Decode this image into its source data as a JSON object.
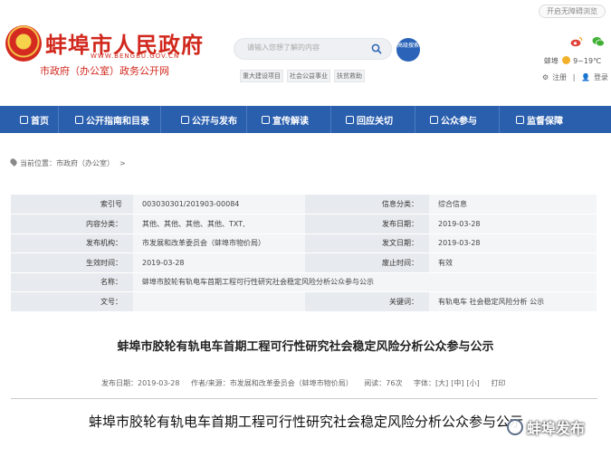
{
  "header": {
    "accessibility_label": "开启无障碍浏览",
    "site_title": "蚌埠市人民政府",
    "site_url": "WWW.BENGBU.GOV.CN",
    "site_subtitle": "市政府（办公室）政务公开网",
    "search_placeholder": "请输入您想了解的内容",
    "advanced_search_label": "高级搜索",
    "hot_tags": [
      "重大建设项目",
      "社会公益事业",
      "扶贫救助"
    ],
    "weather": {
      "city": "蚌埠",
      "temp": "9~19℃"
    },
    "user_links": {
      "register": "注册",
      "login": "登录"
    }
  },
  "nav": {
    "items": [
      {
        "label": "首页",
        "icon": "home-icon"
      },
      {
        "label": "公开指南和目录",
        "icon": "list-icon"
      },
      {
        "label": "公开与发布",
        "icon": "document-icon"
      },
      {
        "label": "宣传解读",
        "icon": "megaphone-icon"
      },
      {
        "label": "回应关切",
        "icon": "chat-icon"
      },
      {
        "label": "公众参与",
        "icon": "people-icon"
      },
      {
        "label": "监督保障",
        "icon": "shield-icon"
      }
    ]
  },
  "breadcrumb": {
    "prefix": "当前位置：",
    "item": "市政府（办公室）",
    "arrow": ">"
  },
  "meta": {
    "rows": [
      {
        "l1": "索引号",
        "v1": "003030301/201903-00084",
        "l2": "信息分类：",
        "v2": "综合信息"
      },
      {
        "l1": "内容分类：",
        "v1": "其他、其他、其他、其他、TXT,",
        "l2": "发布日期：",
        "v2": "2019-03-28"
      },
      {
        "l1": "发布机构：",
        "v1": "市发展和改革委员会（蚌埠市物价局）",
        "l2": "发文日期：",
        "v2": "2019-03-28"
      },
      {
        "l1": "生效时间：",
        "v1": "2019-03-28",
        "l2": "废止时间：",
        "v2": "有效"
      },
      {
        "l1": "名称：",
        "v1": "蚌埠市胶轮有轨电车首期工程可行性研究社会稳定风险分析公众参与公示"
      },
      {
        "l1": "文号：",
        "v1": "",
        "l2": "关键词：",
        "v2": "有轨电车 社会稳定风险分析 公示"
      }
    ]
  },
  "article": {
    "title": "蚌埠市胶轮有轨电车首期工程可行性研究社会稳定风险分析公众参与公示",
    "info": {
      "date": "发布日期：2019-03-28",
      "author": "作者/来源：市发展和改革委员会（蚌埠市物价局）",
      "views": "阅读：76次",
      "font_label": "字体：",
      "font_large": "[大]",
      "font_medium": "[中]",
      "font_small": "[小]",
      "print": "打印"
    },
    "body_heading": "蚌埠市胶轮有轨电车首期工程可行性研究社会稳定风险分析公众参与公示"
  },
  "watermark": {
    "text": "蚌埠发布"
  },
  "colors": {
    "brand_red": "#d1281d",
    "nav_blue": "#2a5fae"
  }
}
